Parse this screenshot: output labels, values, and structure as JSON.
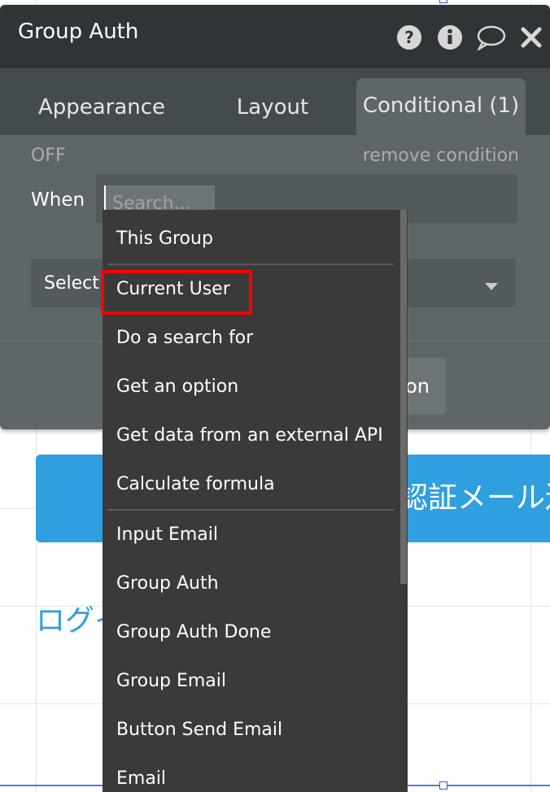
{
  "panel": {
    "title": "Group Auth",
    "tabs": [
      {
        "label": "Appearance",
        "active": false
      },
      {
        "label": "Layout",
        "active": false
      },
      {
        "label": "Conditional (1)",
        "active": true
      }
    ],
    "header_icons": [
      "help-icon",
      "info-icon",
      "comment-icon",
      "close-icon"
    ],
    "off_label": "OFF",
    "remove_condition": "remove condition",
    "when_label": "When",
    "search_placeholder": "Search...",
    "select_label": "Select",
    "partial_button_text": "on"
  },
  "dropdown": {
    "group1": [
      "This Group"
    ],
    "group2": [
      "Current User",
      "Do a search for",
      "Get an option",
      "Get data from an external API",
      "Calculate formula"
    ],
    "group3": [
      "Input Email",
      "Group Auth",
      "Group Auth Done",
      "Group Email",
      "Button Send Email",
      "Email"
    ],
    "highlighted": "Current User"
  },
  "canvas": {
    "blue_button_text": "認証メール送",
    "login_link_text": "ログイ"
  },
  "colors": {
    "header_bg": "#2f3437",
    "panel_bg": "#5e6669",
    "menu_bg": "#3a3a3a",
    "accent_blue": "#2f9fe0",
    "highlight_red": "#ff0000"
  }
}
